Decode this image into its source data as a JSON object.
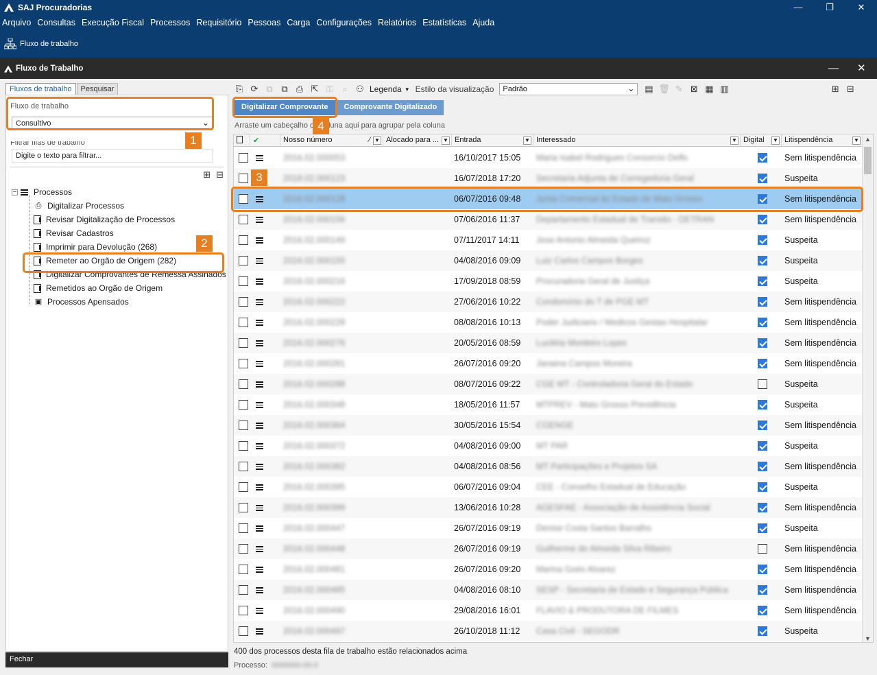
{
  "app": {
    "title": "SAJ Procuradorias"
  },
  "window_controls": {
    "minimize": "—",
    "restore": "❐",
    "close": "✕"
  },
  "menu": [
    "Arquivo",
    "Consultas",
    "Execução Fiscal",
    "Processos",
    "Requisitório",
    "Pessoas",
    "Carga",
    "Configurações",
    "Relatórios",
    "Estatísticas",
    "Ajuda"
  ],
  "ribbon": {
    "item_label": "Fluxo de trabalho",
    "icon": "org-chart-icon"
  },
  "child_window": {
    "title": "Fluxo de Trabalho"
  },
  "left": {
    "tabs": [
      "Fluxos de trabalho",
      "Pesquisar"
    ],
    "workflow_label": "Fluxo de trabalho",
    "workflow_value": "Consultivo",
    "filter_label": "Filtrar filas de trabalho",
    "filter_placeholder": "Digite o texto para filtrar...",
    "tree_root": "Processos",
    "tree_items": [
      "Digitalizar Processos",
      "Revisar Digitalização de Processos",
      "Revisar Cadastros",
      "Imprimir para Devolução (268)",
      "Remeter ao Orgão de Origem (282)",
      "Digitalizar Comprovantes de Remessa Assinados",
      "Remetidos ao Orgão de Origem",
      "Processos Apensados"
    ],
    "close_button": "Fechar"
  },
  "toolbar": {
    "legend_label": "Legenda",
    "view_style_label": "Estilo da visualização",
    "view_style_value": "Padrão"
  },
  "actions": {
    "primary": "Digitalizar Comprovante",
    "secondary": "Comprovante Digitalizado"
  },
  "group_hint": "Arraste um cabeçalho de coluna aqui para agrupar pela coluna",
  "columns": [
    "Nosso número",
    "Alocado para ...",
    "Entrada",
    "Interessado",
    "Digital",
    "Litispendência"
  ],
  "rows": [
    {
      "entrada": "16/10/2017 15:05",
      "digital": true,
      "litis": "Sem litispendência"
    },
    {
      "entrada": "16/07/2018 17:20",
      "digital": true,
      "litis": "Suspeita"
    },
    {
      "entrada": "06/07/2016 09:48",
      "digital": true,
      "litis": "Sem litispendência"
    },
    {
      "entrada": "07/06/2016 11:37",
      "digital": true,
      "litis": "Sem litispendência"
    },
    {
      "entrada": "07/11/2017 14:11",
      "digital": true,
      "litis": "Suspeita"
    },
    {
      "entrada": "04/08/2016 09:09",
      "digital": true,
      "litis": "Suspeita"
    },
    {
      "entrada": "17/09/2018 08:59",
      "digital": true,
      "litis": "Suspeita"
    },
    {
      "entrada": "27/06/2016 10:22",
      "digital": true,
      "litis": "Sem litispendência"
    },
    {
      "entrada": "08/08/2016 10:13",
      "digital": true,
      "litis": "Sem litispendência"
    },
    {
      "entrada": "20/05/2016 08:59",
      "digital": true,
      "litis": "Sem litispendência"
    },
    {
      "entrada": "26/07/2016 09:20",
      "digital": true,
      "litis": "Sem litispendência"
    },
    {
      "entrada": "08/07/2016 09:22",
      "digital": false,
      "litis": "Suspeita"
    },
    {
      "entrada": "18/05/2016 11:57",
      "digital": true,
      "litis": "Suspeita"
    },
    {
      "entrada": "30/05/2016 15:54",
      "digital": true,
      "litis": "Sem litispendência"
    },
    {
      "entrada": "04/08/2016 09:00",
      "digital": true,
      "litis": "Suspeita"
    },
    {
      "entrada": "04/08/2016 08:56",
      "digital": true,
      "litis": "Sem litispendência"
    },
    {
      "entrada": "06/07/2016 09:04",
      "digital": true,
      "litis": "Suspeita"
    },
    {
      "entrada": "13/06/2016 10:28",
      "digital": true,
      "litis": "Sem litispendência"
    },
    {
      "entrada": "26/07/2016 09:19",
      "digital": true,
      "litis": "Suspeita"
    },
    {
      "entrada": "26/07/2016 09:19",
      "digital": false,
      "litis": "Sem litispendência"
    },
    {
      "entrada": "26/07/2016 09:20",
      "digital": true,
      "litis": "Sem litispendência"
    },
    {
      "entrada": "04/08/2016 08:10",
      "digital": true,
      "litis": "Sem litispendência"
    },
    {
      "entrada": "29/08/2016 16:01",
      "digital": true,
      "litis": "Sem litispendência"
    },
    {
      "entrada": "26/10/2018 11:12",
      "digital": true,
      "litis": "Suspeita"
    }
  ],
  "footer": {
    "summary": "400 dos  processos desta fila de trabalho estão relacionados acima",
    "process_label": "Processo:"
  },
  "annotations": [
    "1",
    "2",
    "3",
    "4"
  ],
  "colors": {
    "title_bar": "#0b3d70",
    "highlight": "#e67e22",
    "selected_row": "#9ecbf0",
    "action_primary": "#4d87c7",
    "action_secondary": "#6b9bd0"
  }
}
